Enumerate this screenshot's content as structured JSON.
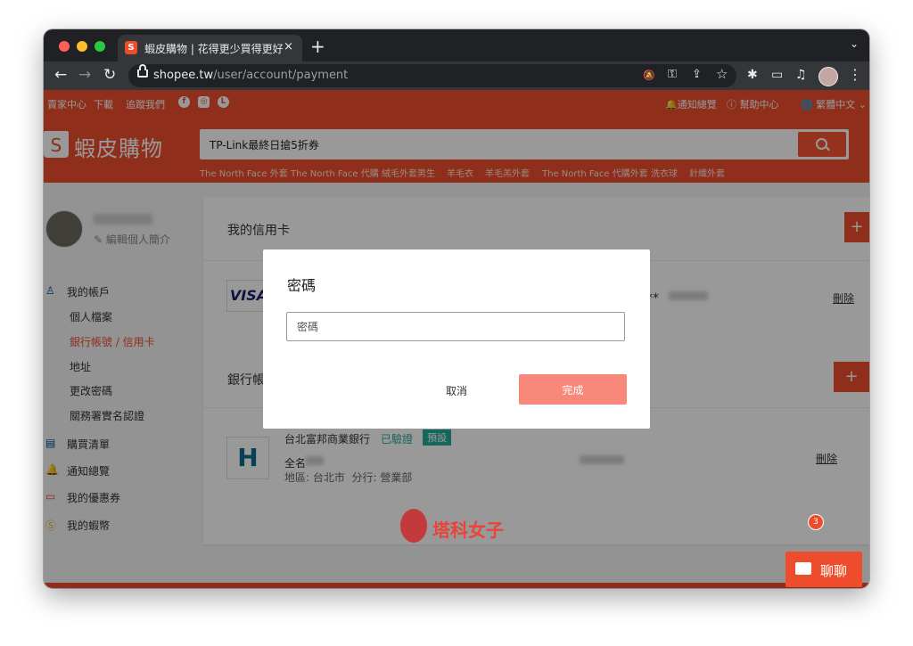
{
  "browser": {
    "tab_title": "蝦皮購物 | 花得更少買得更好",
    "tab_favicon": "S",
    "tab_close": "×",
    "new_tab": "+",
    "tab_menu": "⌄",
    "url_host": "shopee.tw",
    "url_path": "/user/account/payment",
    "icons": [
      "back-icon",
      "forward-icon",
      "reload-icon",
      "lock-icon",
      "notifications-off-icon",
      "key-icon",
      "share-icon",
      "star-icon",
      "extensions-icon",
      "cast-icon",
      "media-icon",
      "profile-avatar",
      "menu-icon"
    ],
    "glyphs": {
      "back": "←",
      "forward": "→",
      "reload": "↻",
      "mute": "🔕",
      "key": "⚿",
      "share": "⇪",
      "star": "☆",
      "extensions": "✱",
      "cast": "▭",
      "media": "♫",
      "menu": "⋮"
    }
  },
  "header": {
    "top_links": {
      "seller_center": "賣家中心",
      "download": "下載",
      "follow_us": "追蹤我們"
    },
    "social": {
      "facebook": "f",
      "instagram": "◎",
      "line": "L"
    },
    "right_links": {
      "notifications": "通知總覽",
      "help": "幫助中心",
      "language": "繁體中文"
    },
    "logo_text": "蝦皮購物",
    "logo_mark": "S",
    "search_value": "TP-Link最終日搶5折券",
    "keywords": [
      "The North Face 外套",
      "The North Face 代購",
      "絨毛外套男生",
      "羊毛衣",
      "羊毛羔外套",
      "The North Face 代購外套",
      "洗衣球",
      "針織外套"
    ]
  },
  "sidebar": {
    "edit_profile": "編輯個人簡介",
    "my_account": "我的帳戶",
    "sub_items": [
      "個人檔案",
      "銀行帳號 / 信用卡",
      "地址",
      "更改密碼",
      "關務署實名認證"
    ],
    "purchases": "購買清單",
    "notifications": "通知總覽",
    "vouchers": "我的優惠券",
    "coins": "我的蝦幣"
  },
  "main": {
    "credit_card_title": "我的信用卡",
    "visa": "VISA",
    "masked": "**",
    "delete": "刪除",
    "bank_title": "銀行帳",
    "bank_name": "台北富邦商業銀行",
    "verified": "已驗證",
    "default": "預設",
    "full_name_label": "全名",
    "region": "地區: 台北市  分行: 營業部",
    "add": "+"
  },
  "modal": {
    "title": "密碼",
    "placeholder": "密碼",
    "cancel": "取消",
    "confirm": "完成"
  },
  "chat": {
    "label": "聊聊",
    "badge": "3"
  },
  "watermark": {
    "text": "塔科女子"
  },
  "colors": {
    "brand": "#ee4d2d",
    "confirm": "#f7887a",
    "verified": "#26aa99",
    "link": "#ee4d2d"
  }
}
